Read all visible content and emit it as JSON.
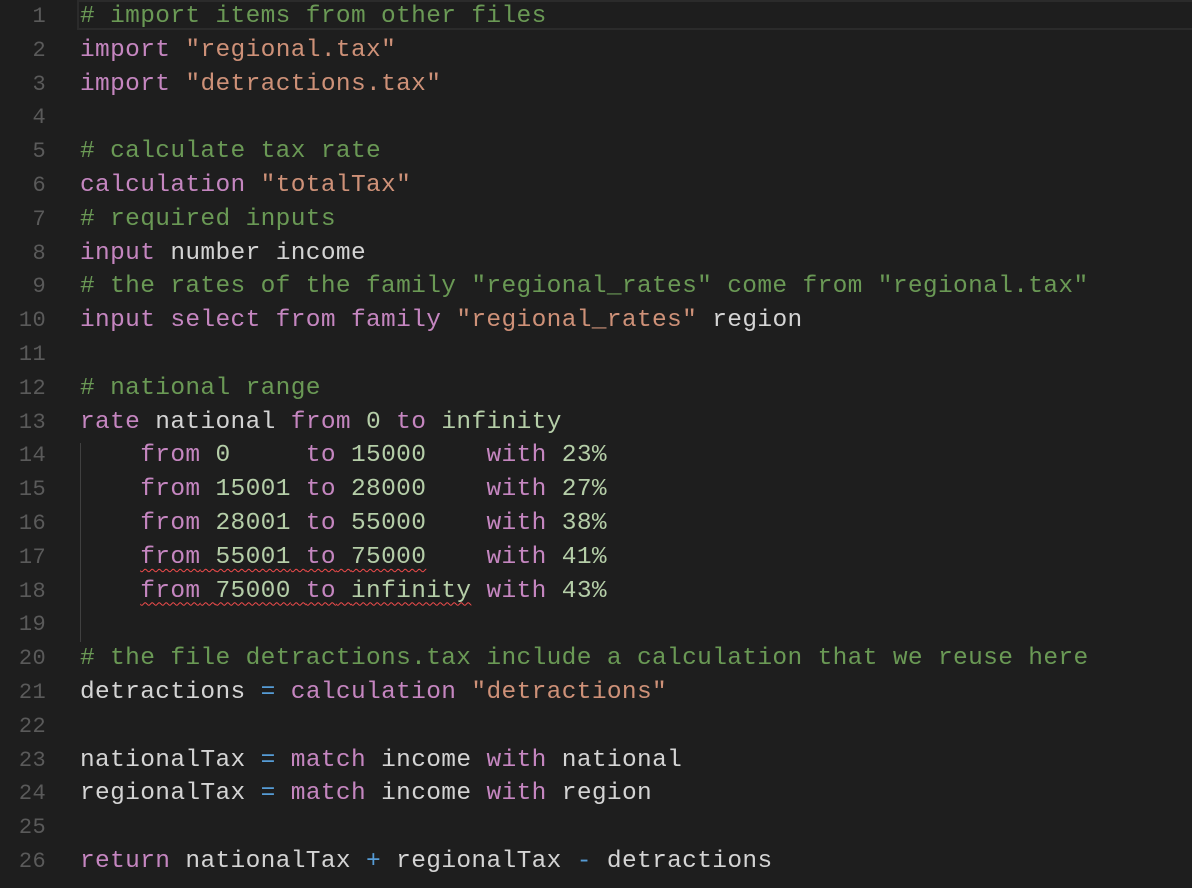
{
  "editor": {
    "current_line": 1,
    "colors": {
      "background": "#1e1e1e",
      "comment": "#6a9955",
      "keyword": "#c586c0",
      "string": "#ce9178",
      "number": "#b5cea8",
      "identifier": "#d4d4d4",
      "operator": "#569cd6",
      "line_number": "#5a5a5a",
      "error_squiggle": "#f14c4c"
    },
    "lines": [
      {
        "n": "1",
        "tokens": [
          {
            "t": "comment",
            "v": "# import items from other files"
          }
        ]
      },
      {
        "n": "2",
        "tokens": [
          {
            "t": "keyword",
            "v": "import"
          },
          {
            "t": "plain",
            "v": " "
          },
          {
            "t": "string",
            "v": "\"regional.tax\""
          }
        ]
      },
      {
        "n": "3",
        "tokens": [
          {
            "t": "keyword",
            "v": "import"
          },
          {
            "t": "plain",
            "v": " "
          },
          {
            "t": "string",
            "v": "\"detractions.tax\""
          }
        ]
      },
      {
        "n": "4",
        "tokens": []
      },
      {
        "n": "5",
        "tokens": [
          {
            "t": "comment",
            "v": "# calculate tax rate"
          }
        ]
      },
      {
        "n": "6",
        "tokens": [
          {
            "t": "keyword",
            "v": "calculation"
          },
          {
            "t": "plain",
            "v": " "
          },
          {
            "t": "string",
            "v": "\"totalTax\""
          }
        ]
      },
      {
        "n": "7",
        "tokens": [
          {
            "t": "comment",
            "v": "# required inputs"
          }
        ]
      },
      {
        "n": "8",
        "tokens": [
          {
            "t": "keyword",
            "v": "input"
          },
          {
            "t": "plain",
            "v": " "
          },
          {
            "t": "ident",
            "v": "number income"
          }
        ]
      },
      {
        "n": "9",
        "tokens": [
          {
            "t": "comment",
            "v": "# the rates of the family \"regional_rates\" come from \"regional.tax\""
          }
        ]
      },
      {
        "n": "10",
        "tokens": [
          {
            "t": "keyword",
            "v": "input select from family"
          },
          {
            "t": "plain",
            "v": " "
          },
          {
            "t": "string",
            "v": "\"regional_rates\""
          },
          {
            "t": "plain",
            "v": " "
          },
          {
            "t": "ident",
            "v": "region"
          }
        ]
      },
      {
        "n": "11",
        "tokens": []
      },
      {
        "n": "12",
        "tokens": [
          {
            "t": "comment",
            "v": "# national range"
          }
        ]
      },
      {
        "n": "13",
        "tokens": [
          {
            "t": "keyword",
            "v": "rate"
          },
          {
            "t": "plain",
            "v": " "
          },
          {
            "t": "ident",
            "v": "national"
          },
          {
            "t": "plain",
            "v": " "
          },
          {
            "t": "keyword",
            "v": "from"
          },
          {
            "t": "plain",
            "v": " "
          },
          {
            "t": "number",
            "v": "0"
          },
          {
            "t": "plain",
            "v": " "
          },
          {
            "t": "keyword",
            "v": "to"
          },
          {
            "t": "plain",
            "v": " "
          },
          {
            "t": "number",
            "v": "infinity"
          }
        ]
      },
      {
        "n": "14",
        "indent": true,
        "tokens": [
          {
            "t": "plain",
            "v": "    "
          },
          {
            "t": "keyword",
            "v": "from"
          },
          {
            "t": "plain",
            "v": " "
          },
          {
            "t": "number",
            "v": "0"
          },
          {
            "t": "plain",
            "v": "     "
          },
          {
            "t": "keyword",
            "v": "to"
          },
          {
            "t": "plain",
            "v": " "
          },
          {
            "t": "number",
            "v": "15000"
          },
          {
            "t": "plain",
            "v": "    "
          },
          {
            "t": "keyword",
            "v": "with"
          },
          {
            "t": "plain",
            "v": " "
          },
          {
            "t": "number",
            "v": "23%"
          }
        ]
      },
      {
        "n": "15",
        "indent": true,
        "tokens": [
          {
            "t": "plain",
            "v": "    "
          },
          {
            "t": "keyword",
            "v": "from"
          },
          {
            "t": "plain",
            "v": " "
          },
          {
            "t": "number",
            "v": "15001"
          },
          {
            "t": "plain",
            "v": " "
          },
          {
            "t": "keyword",
            "v": "to"
          },
          {
            "t": "plain",
            "v": " "
          },
          {
            "t": "number",
            "v": "28000"
          },
          {
            "t": "plain",
            "v": "    "
          },
          {
            "t": "keyword",
            "v": "with"
          },
          {
            "t": "plain",
            "v": " "
          },
          {
            "t": "number",
            "v": "27%"
          }
        ]
      },
      {
        "n": "16",
        "indent": true,
        "tokens": [
          {
            "t": "plain",
            "v": "    "
          },
          {
            "t": "keyword",
            "v": "from"
          },
          {
            "t": "plain",
            "v": " "
          },
          {
            "t": "number",
            "v": "28001"
          },
          {
            "t": "plain",
            "v": " "
          },
          {
            "t": "keyword",
            "v": "to"
          },
          {
            "t": "plain",
            "v": " "
          },
          {
            "t": "number",
            "v": "55000"
          },
          {
            "t": "plain",
            "v": "    "
          },
          {
            "t": "keyword",
            "v": "with"
          },
          {
            "t": "plain",
            "v": " "
          },
          {
            "t": "number",
            "v": "38%"
          }
        ]
      },
      {
        "n": "17",
        "indent": true,
        "tokens": [
          {
            "t": "plain",
            "v": "    "
          },
          {
            "t": "keyword",
            "v": "from",
            "err": true
          },
          {
            "t": "plain",
            "v": " ",
            "err": true
          },
          {
            "t": "number",
            "v": "55001",
            "err": true
          },
          {
            "t": "plain",
            "v": " ",
            "err": true
          },
          {
            "t": "keyword",
            "v": "to",
            "err": true
          },
          {
            "t": "plain",
            "v": " ",
            "err": true
          },
          {
            "t": "number",
            "v": "75000",
            "err": true
          },
          {
            "t": "plain",
            "v": "    "
          },
          {
            "t": "keyword",
            "v": "with"
          },
          {
            "t": "plain",
            "v": " "
          },
          {
            "t": "number",
            "v": "41%"
          }
        ]
      },
      {
        "n": "18",
        "indent": true,
        "tokens": [
          {
            "t": "plain",
            "v": "    "
          },
          {
            "t": "keyword",
            "v": "from",
            "err": true
          },
          {
            "t": "plain",
            "v": " ",
            "err": true
          },
          {
            "t": "number",
            "v": "75000",
            "err": true
          },
          {
            "t": "plain",
            "v": " ",
            "err": true
          },
          {
            "t": "keyword",
            "v": "to",
            "err": true
          },
          {
            "t": "plain",
            "v": " ",
            "err": true
          },
          {
            "t": "number",
            "v": "infinity",
            "err": true
          },
          {
            "t": "plain",
            "v": " "
          },
          {
            "t": "keyword",
            "v": "with"
          },
          {
            "t": "plain",
            "v": " "
          },
          {
            "t": "number",
            "v": "43%"
          }
        ]
      },
      {
        "n": "19",
        "indent": true,
        "tokens": []
      },
      {
        "n": "20",
        "tokens": [
          {
            "t": "comment",
            "v": "# the file detractions.tax include a calculation that we reuse here"
          }
        ]
      },
      {
        "n": "21",
        "tokens": [
          {
            "t": "ident",
            "v": "detractions"
          },
          {
            "t": "plain",
            "v": " "
          },
          {
            "t": "op",
            "v": "="
          },
          {
            "t": "plain",
            "v": " "
          },
          {
            "t": "keyword",
            "v": "calculation"
          },
          {
            "t": "plain",
            "v": " "
          },
          {
            "t": "string",
            "v": "\"detractions\""
          }
        ]
      },
      {
        "n": "22",
        "tokens": []
      },
      {
        "n": "23",
        "tokens": [
          {
            "t": "ident",
            "v": "nationalTax"
          },
          {
            "t": "plain",
            "v": " "
          },
          {
            "t": "op",
            "v": "="
          },
          {
            "t": "plain",
            "v": " "
          },
          {
            "t": "keyword",
            "v": "match"
          },
          {
            "t": "plain",
            "v": " "
          },
          {
            "t": "ident",
            "v": "income"
          },
          {
            "t": "plain",
            "v": " "
          },
          {
            "t": "keyword",
            "v": "with"
          },
          {
            "t": "plain",
            "v": " "
          },
          {
            "t": "ident",
            "v": "national"
          }
        ]
      },
      {
        "n": "24",
        "tokens": [
          {
            "t": "ident",
            "v": "regionalTax"
          },
          {
            "t": "plain",
            "v": " "
          },
          {
            "t": "op",
            "v": "="
          },
          {
            "t": "plain",
            "v": " "
          },
          {
            "t": "keyword",
            "v": "match"
          },
          {
            "t": "plain",
            "v": " "
          },
          {
            "t": "ident",
            "v": "income"
          },
          {
            "t": "plain",
            "v": " "
          },
          {
            "t": "keyword",
            "v": "with"
          },
          {
            "t": "plain",
            "v": " "
          },
          {
            "t": "ident",
            "v": "region"
          }
        ]
      },
      {
        "n": "25",
        "tokens": []
      },
      {
        "n": "26",
        "tokens": [
          {
            "t": "keyword",
            "v": "return"
          },
          {
            "t": "plain",
            "v": " "
          },
          {
            "t": "ident",
            "v": "nationalTax"
          },
          {
            "t": "plain",
            "v": " "
          },
          {
            "t": "op",
            "v": "+"
          },
          {
            "t": "plain",
            "v": " "
          },
          {
            "t": "ident",
            "v": "regionalTax"
          },
          {
            "t": "plain",
            "v": " "
          },
          {
            "t": "op",
            "v": "-"
          },
          {
            "t": "plain",
            "v": " "
          },
          {
            "t": "ident",
            "v": "detractions"
          }
        ]
      }
    ]
  }
}
